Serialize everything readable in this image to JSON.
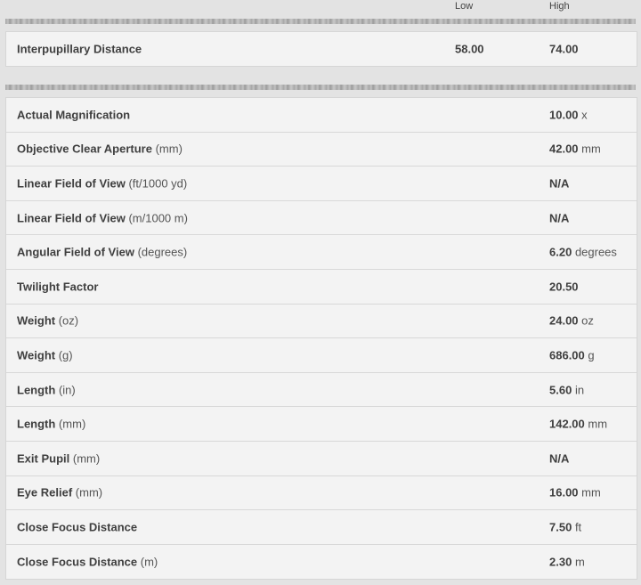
{
  "columns": {
    "low": "Low",
    "high": "High"
  },
  "ipd": {
    "label": "Interpupillary Distance",
    "low": "58.00",
    "high": "74.00"
  },
  "specs": [
    {
      "label": "Actual Magnification",
      "unit_label": "",
      "value": "10.00",
      "value_unit": "x"
    },
    {
      "label": "Objective Clear Aperture",
      "unit_label": "(mm)",
      "value": "42.00",
      "value_unit": "mm"
    },
    {
      "label": "Linear Field of View",
      "unit_label": "(ft/1000 yd)",
      "value": "N/A",
      "value_unit": ""
    },
    {
      "label": "Linear Field of View",
      "unit_label": "(m/1000 m)",
      "value": "N/A",
      "value_unit": ""
    },
    {
      "label": "Angular Field of View",
      "unit_label": "(degrees)",
      "value": "6.20",
      "value_unit": "degrees"
    },
    {
      "label": "Twilight Factor",
      "unit_label": "",
      "value": "20.50",
      "value_unit": ""
    },
    {
      "label": "Weight",
      "unit_label": "(oz)",
      "value": "24.00",
      "value_unit": "oz"
    },
    {
      "label": "Weight",
      "unit_label": "(g)",
      "value": "686.00",
      "value_unit": "g"
    },
    {
      "label": "Length",
      "unit_label": "(in)",
      "value": "5.60",
      "value_unit": "in"
    },
    {
      "label": "Length",
      "unit_label": "(mm)",
      "value": "142.00",
      "value_unit": "mm"
    },
    {
      "label": "Exit Pupil",
      "unit_label": "(mm)",
      "value": "N/A",
      "value_unit": ""
    },
    {
      "label": "Eye Relief",
      "unit_label": "(mm)",
      "value": "16.00",
      "value_unit": "mm"
    },
    {
      "label": "Close Focus Distance",
      "unit_label": "",
      "value": "7.50",
      "value_unit": "ft"
    },
    {
      "label": "Close Focus Distance",
      "unit_label": "(m)",
      "value": "2.30",
      "value_unit": "m"
    }
  ]
}
